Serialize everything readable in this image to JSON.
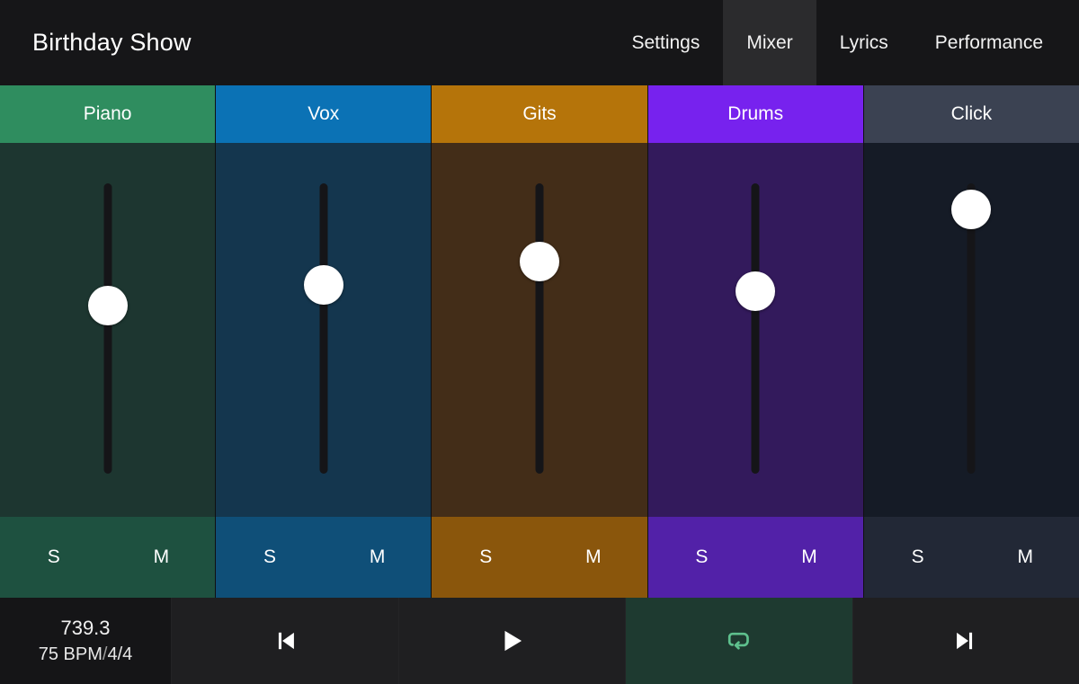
{
  "header": {
    "title": "Birthday Show",
    "tabs": [
      {
        "label": "Settings",
        "active": false
      },
      {
        "label": "Mixer",
        "active": true
      },
      {
        "label": "Lyrics",
        "active": false
      },
      {
        "label": "Performance",
        "active": false
      }
    ]
  },
  "mixer": {
    "solo_label": "S",
    "mute_label": "M",
    "channels": [
      {
        "name": "Piano",
        "header_color": "#2f8d5f",
        "body_color": "#1d3630",
        "footer_color": "#1e5140",
        "fader_percent": 58,
        "solo": "S",
        "mute": "M"
      },
      {
        "name": "Vox",
        "header_color": "#0b72b5",
        "body_color": "#14364e",
        "footer_color": "#0f4f78",
        "fader_percent": 65,
        "solo": "S",
        "mute": "M"
      },
      {
        "name": "Gits",
        "header_color": "#b5740a",
        "body_color": "#432d18",
        "footer_color": "#8a560c",
        "fader_percent": 73,
        "solo": "S",
        "mute": "M"
      },
      {
        "name": "Drums",
        "header_color": "#7722ee",
        "body_color": "#331a5c",
        "footer_color": "#5221a8",
        "fader_percent": 63,
        "solo": "S",
        "mute": "M"
      },
      {
        "name": "Click",
        "header_color": "#3b4252",
        "body_color": "#151b26",
        "footer_color": "#222836",
        "fader_percent": 91,
        "solo": "S",
        "mute": "M"
      }
    ]
  },
  "transport": {
    "position": "739.3",
    "tempo": "75 BPM",
    "separator": "/",
    "time_signature": "4/4",
    "buttons": [
      {
        "name": "skip-back",
        "icon": "skip-back-icon",
        "active": false
      },
      {
        "name": "play",
        "icon": "play-icon",
        "active": false
      },
      {
        "name": "loop",
        "icon": "loop-icon",
        "active": true
      },
      {
        "name": "skip-forward",
        "icon": "skip-forward-icon",
        "active": false
      }
    ],
    "loop_active_color": "#5ec08d",
    "loop_active_bg": "#1e3a30"
  }
}
